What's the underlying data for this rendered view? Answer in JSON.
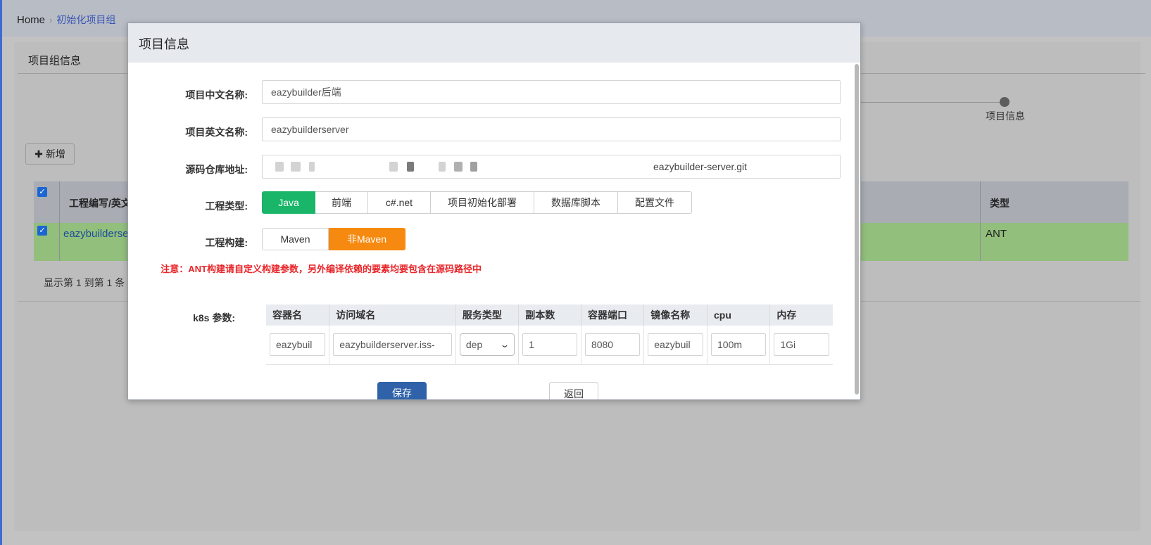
{
  "breadcrumb": {
    "home": "Home",
    "separator": "›",
    "current": "初始化项目组"
  },
  "background": {
    "panel_title": "项目组信息",
    "step_label": "项目信息",
    "add_button": {
      "icon": "plus-icon",
      "label": "新增"
    },
    "table": {
      "header_col2": "工程编写/英文",
      "header_type": "类型",
      "row": {
        "name": "eazybuilderse",
        "type": "ANT"
      }
    },
    "footer_text": "显示第 1 到第 1 条"
  },
  "modal": {
    "title": "项目信息",
    "fields": {
      "cn_name": {
        "label": "项目中文名称:",
        "value": "eazybuilder后端"
      },
      "en_name": {
        "label": "项目英文名称:",
        "value": "eazybuilderserver"
      },
      "repo": {
        "label": "源码仓库地址:",
        "value_visible_suffix": "eazybuilder-server.git"
      }
    },
    "project_type": {
      "label": "工程类型:",
      "options": [
        "Java",
        "前端",
        "c#.net",
        "项目初始化部署",
        "数据库脚本",
        "配置文件"
      ],
      "selected": "Java"
    },
    "build": {
      "label": "工程构建:",
      "options": [
        "Maven",
        "非Maven"
      ],
      "selected": "非Maven"
    },
    "warning": "注意：ANT构建请自定义构建参数，另外编译依赖的要素均要包含在源码路径中",
    "k8s": {
      "label": "k8s 参数:",
      "columns": [
        "容器名",
        "访问域名",
        "服务类型",
        "副本数",
        "容器端口",
        "镜像名称",
        "cpu",
        "内存"
      ],
      "row": {
        "container_name": "eazybuil",
        "domain": "eazybuilderserver.iss-",
        "service_type": "dep",
        "replicas": "1",
        "port": "8080",
        "image": "eazybuil",
        "cpu": "100m",
        "memory": "1Gi"
      }
    },
    "save_button": "保存",
    "back_button": "返回"
  },
  "colors": {
    "java_green": "#19b568",
    "non_maven_orange": "#f6890f",
    "warning_red": "#e8262a",
    "save_blue": "#2f62a8"
  }
}
